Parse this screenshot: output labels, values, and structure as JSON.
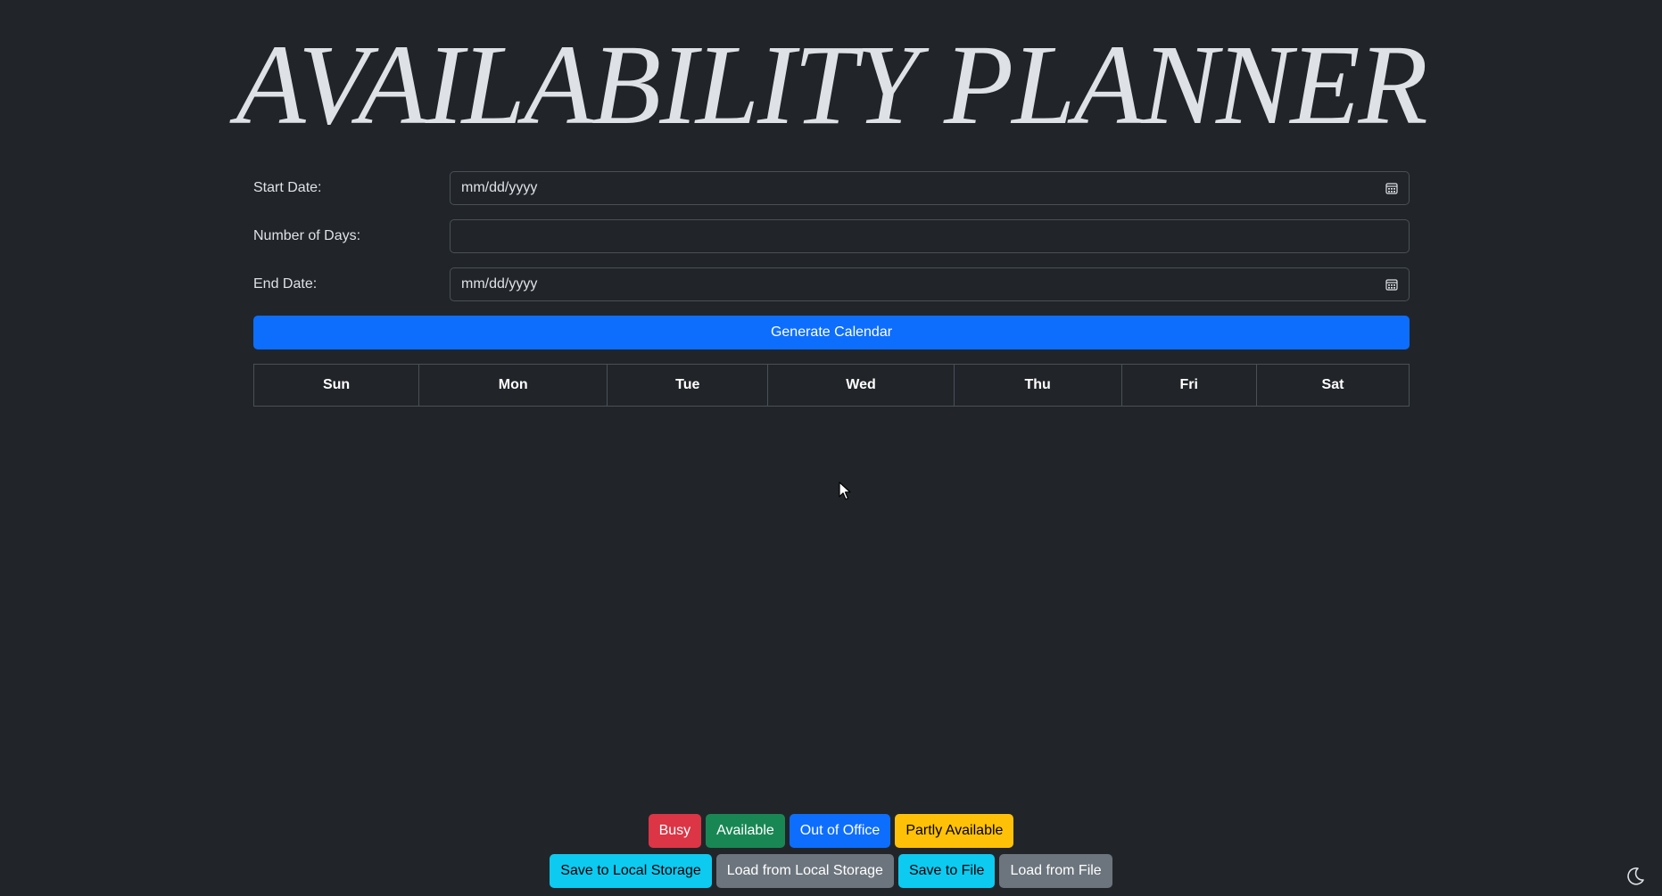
{
  "page": {
    "title": "AVAILABILITY PLANNER"
  },
  "form": {
    "start_date": {
      "label": "Start Date:",
      "placeholder": "mm/dd/yyyy",
      "icon": "calendar-icon"
    },
    "num_days": {
      "label": "Number of Days:",
      "value": ""
    },
    "end_date": {
      "label": "End Date:",
      "placeholder": "mm/dd/yyyy",
      "icon": "calendar-icon"
    },
    "generate_label": "Generate Calendar"
  },
  "calendar": {
    "days": [
      "Sun",
      "Mon",
      "Tue",
      "Wed",
      "Thu",
      "Fri",
      "Sat"
    ]
  },
  "legend": {
    "busy": "Busy",
    "available": "Available",
    "out_of_office": "Out of Office",
    "partly_available": "Partly Available"
  },
  "actions": {
    "save_local": "Save to Local Storage",
    "load_local": "Load from Local Storage",
    "save_file": "Save to File",
    "load_file": "Load from File"
  },
  "theme_toggle": {
    "icon": "moon-icon"
  },
  "colors": {
    "background": "#212529",
    "primary": "#0d6efd",
    "danger": "#dc3545",
    "success": "#198754",
    "warning": "#ffc107",
    "info": "#0dcaf0",
    "secondary": "#6c757d"
  }
}
